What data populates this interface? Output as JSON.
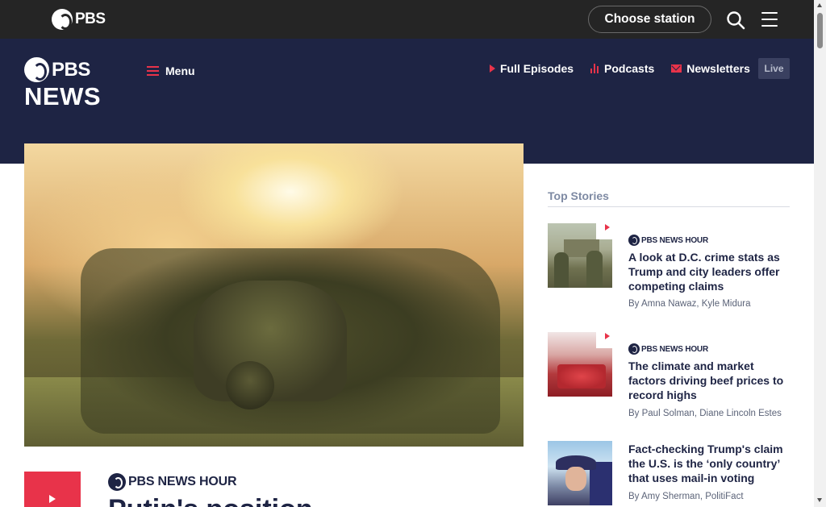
{
  "top_bar": {
    "brand": "PBS",
    "station_button": "Choose station",
    "icons": [
      "search-icon",
      "hamburger-menu-icon"
    ]
  },
  "header": {
    "logo_line1": "PBS",
    "logo_line2": "NEWS",
    "menu_label": "Menu",
    "nav": [
      {
        "label": "Full Episodes",
        "icon": "play-icon"
      },
      {
        "label": "Podcasts",
        "icon": "bar-chart-icon"
      },
      {
        "label": "Newsletters",
        "icon": "mail-icon"
      }
    ],
    "live_label": "Live"
  },
  "hero": {
    "brand": "PBS NEWS HOUR",
    "title": "Putin's position"
  },
  "top_stories": {
    "heading": "Top Stories",
    "items": [
      {
        "brand": "PBS NEWS HOUR",
        "title": "A look at D.C. crime stats as Trump and city leaders offer competing claims",
        "byline": "By Amna Nawaz, Kyle Midura"
      },
      {
        "brand": "PBS NEWS HOUR",
        "title": "The climate and market factors driving beef prices to record highs",
        "byline": "By Paul Solman, Diane Lincoln Estes"
      },
      {
        "title": "Fact-checking Trump's claim the U.S. is the ‘only country’ that uses mail-in voting",
        "byline": "By Amy Sherman, PolitiFact"
      }
    ]
  },
  "colors": {
    "navy": "#1e2444",
    "accent_red": "#e8334a",
    "top_bar": "#252525"
  }
}
